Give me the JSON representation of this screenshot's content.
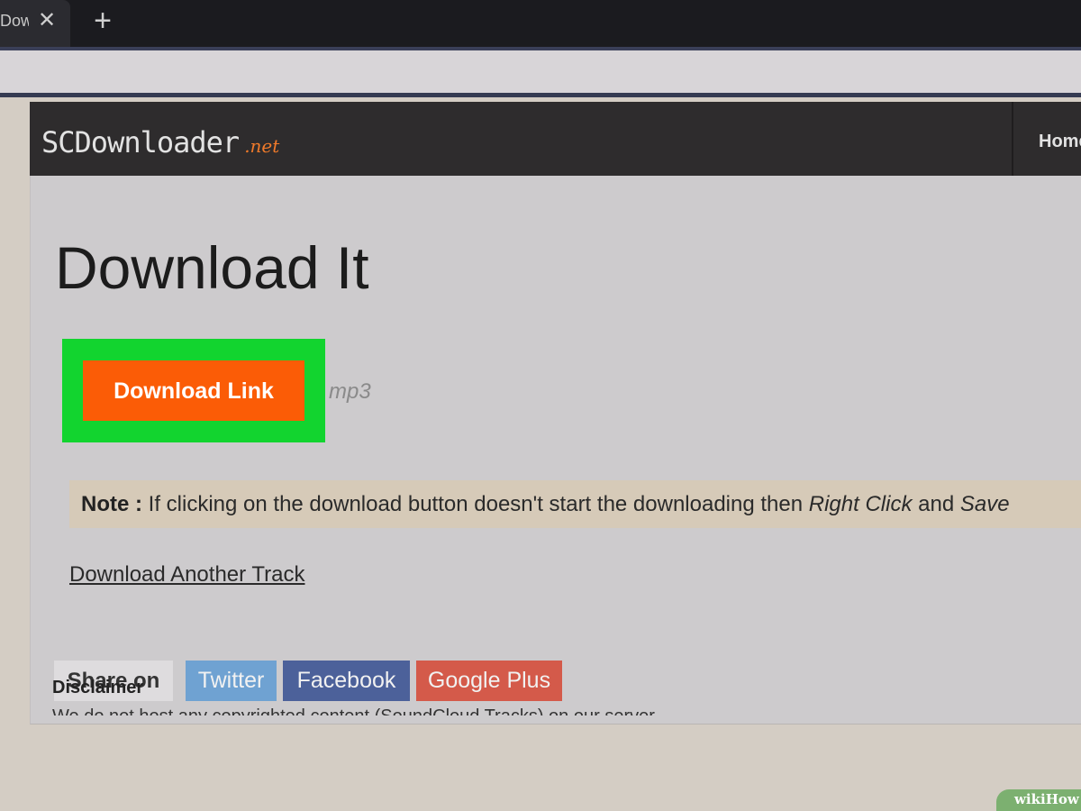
{
  "browser": {
    "tab_title": "Down",
    "close_glyph": "✕",
    "new_tab_glyph": "+"
  },
  "site": {
    "logo_main": "SCDownloader",
    "logo_tld": ".net",
    "nav_home": "Home"
  },
  "content": {
    "headline": "Download It",
    "download_button": "Download Link",
    "format": "mp3",
    "note_label": "Note :",
    "note_text": "If clicking on the download button doesn't start the downloading then",
    "note_emphasis1": "Right Click",
    "note_and": "and",
    "note_emphasis2": "Save",
    "another_track": "Download Another Track",
    "share_label": "Share on",
    "share_buttons": [
      {
        "label": "Twitter",
        "color": "#6fa2d2"
      },
      {
        "label": "Facebook",
        "color": "#4c619a"
      },
      {
        "label": "Google Plus",
        "color": "#d45a4a"
      }
    ]
  },
  "footer": {
    "disclaimer_title": "Disclaimer",
    "disclaimer_text": "We do not host any copyrighted content (SoundCloud Tracks) on our server."
  },
  "watermark": "wikiHow",
  "colors": {
    "highlight": "#12d42f",
    "button": "#fb5c06",
    "header": "#2e2c2d"
  }
}
